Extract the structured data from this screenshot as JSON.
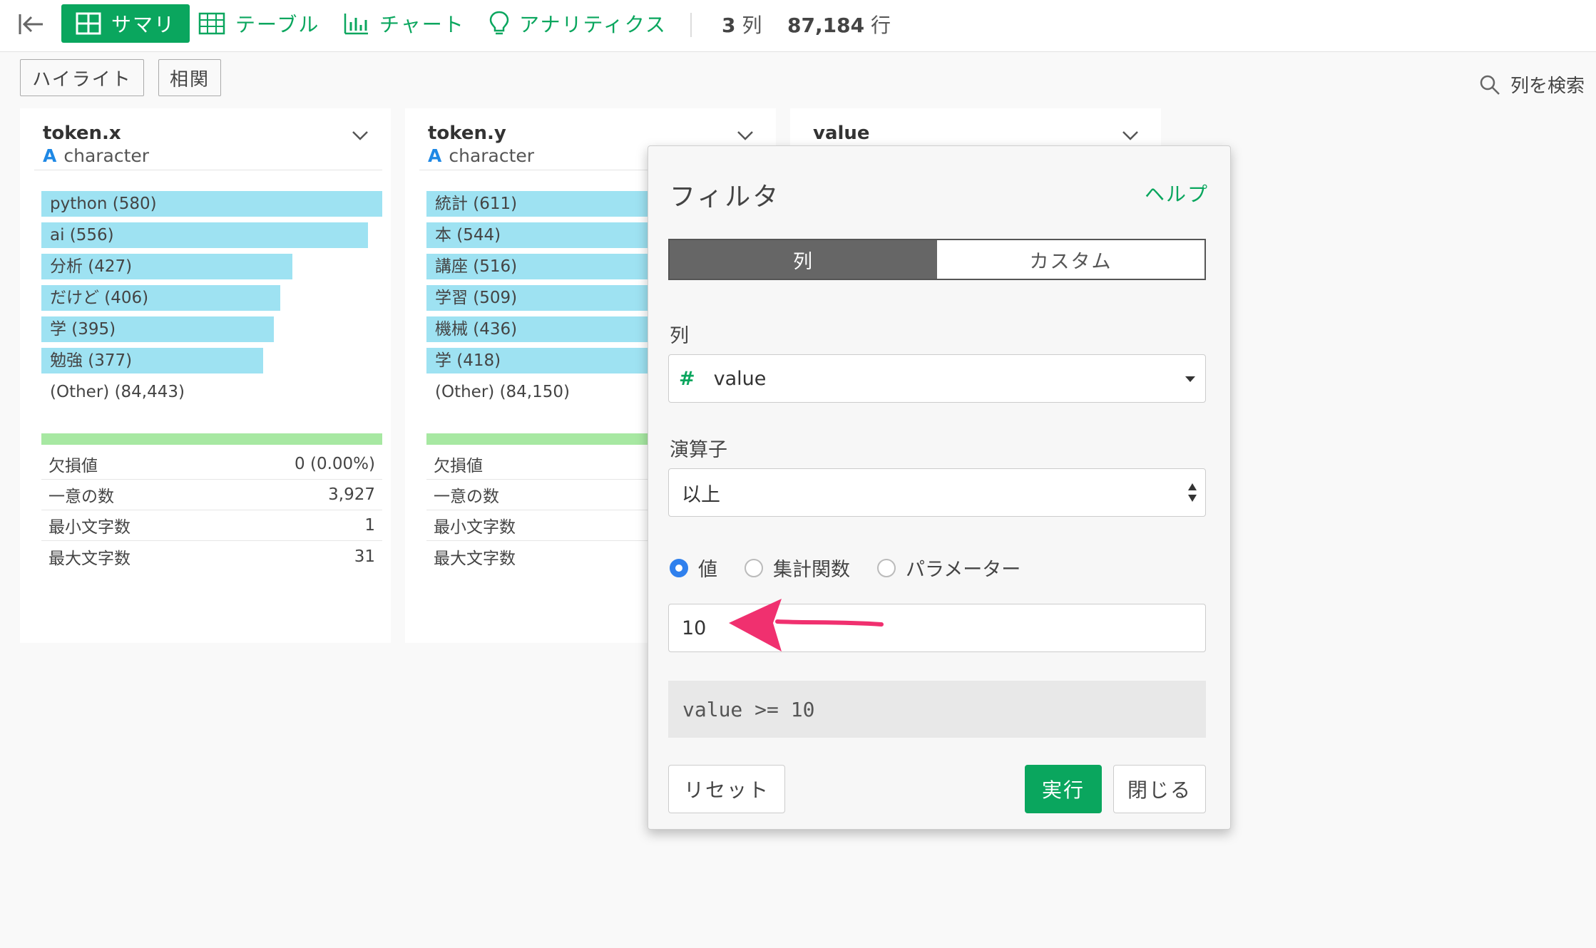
{
  "toolbar": {
    "tabs": [
      {
        "label": "サマリ",
        "active": true,
        "icon": "grid-icon"
      },
      {
        "label": "テーブル",
        "active": false,
        "icon": "table-icon"
      },
      {
        "label": "チャート",
        "active": false,
        "icon": "bar-chart-icon"
      },
      {
        "label": "アナリティクス",
        "active": false,
        "icon": "lightbulb-icon"
      }
    ],
    "columns_count": "3",
    "columns_unit": "列",
    "rows_count": "87,184",
    "rows_unit": "行"
  },
  "actions": {
    "highlight": "ハイライト",
    "correlation": "相関",
    "search_columns": "列を検索"
  },
  "cards": [
    {
      "name": "token.x",
      "type_icon": "A",
      "type": "character",
      "bars": [
        {
          "label": "python (580)",
          "value": 580
        },
        {
          "label": "ai (556)",
          "value": 556
        },
        {
          "label": "分析 (427)",
          "value": 427
        },
        {
          "label": "だけど (406)",
          "value": 406
        },
        {
          "label": "学 (395)",
          "value": 395
        },
        {
          "label": "勉強 (377)",
          "value": 377
        }
      ],
      "other": "(Other) (84,443)",
      "stats": [
        {
          "label": "欠損値",
          "value": "0 (0.00%)"
        },
        {
          "label": "一意の数",
          "value": "3,927"
        },
        {
          "label": "最小文字数",
          "value": "1"
        },
        {
          "label": "最大文字数",
          "value": "31"
        }
      ]
    },
    {
      "name": "token.y",
      "type_icon": "A",
      "type": "character",
      "bars": [
        {
          "label": "統計 (611)",
          "value": 611
        },
        {
          "label": "本 (544)",
          "value": 544
        },
        {
          "label": "講座 (516)",
          "value": 516
        },
        {
          "label": "学習 (509)",
          "value": 509
        },
        {
          "label": "機械 (436)",
          "value": 436
        },
        {
          "label": "学 (418)",
          "value": 418
        }
      ],
      "other": "(Other) (84,150)",
      "stats": [
        {
          "label": "欠損値",
          "value": ""
        },
        {
          "label": "一意の数",
          "value": ""
        },
        {
          "label": "最小文字数",
          "value": ""
        },
        {
          "label": "最大文字数",
          "value": ""
        }
      ]
    },
    {
      "name": "value"
    }
  ],
  "filter": {
    "title": "フィルタ",
    "help": "ヘルプ",
    "mode_tabs": [
      {
        "label": "列",
        "active": true
      },
      {
        "label": "カスタム",
        "active": false
      }
    ],
    "column_label": "列",
    "column_icon": "#",
    "column_value": "value",
    "operator_label": "演算子",
    "operator_value": "以上",
    "value_types": [
      {
        "label": "値",
        "selected": true
      },
      {
        "label": "集計関数",
        "selected": false
      },
      {
        "label": "パラメーター",
        "selected": false
      }
    ],
    "value": "10",
    "expression": "value >= 10",
    "reset": "リセット",
    "run": "実行",
    "close": "閉じる"
  },
  "colors": {
    "accent": "#0aa65e",
    "bar": "#9ee2f2",
    "annotation_arrow": "#f0306f"
  }
}
